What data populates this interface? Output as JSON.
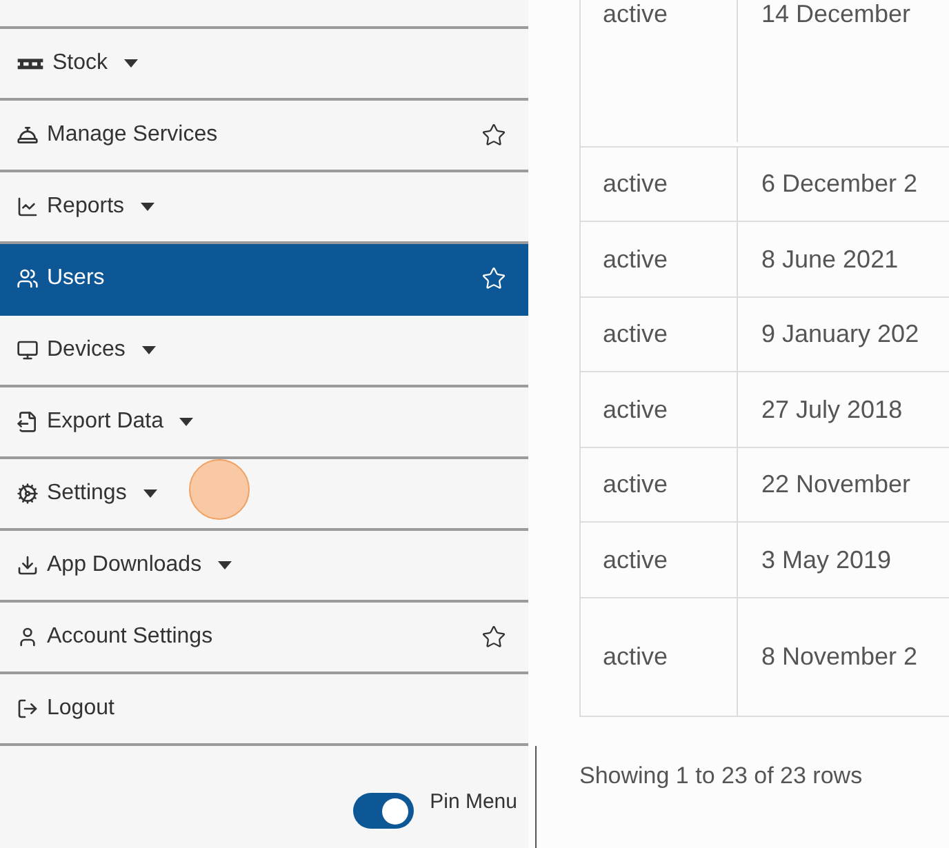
{
  "sidebar": {
    "items": [
      {
        "label": "Stock",
        "dropdown": true,
        "star": false,
        "selected": false
      },
      {
        "label": "Manage Services",
        "dropdown": false,
        "star": true,
        "selected": false
      },
      {
        "label": "Reports",
        "dropdown": true,
        "star": false,
        "selected": false
      },
      {
        "label": "Users",
        "dropdown": false,
        "star": true,
        "selected": true
      },
      {
        "label": "Devices",
        "dropdown": true,
        "star": false,
        "selected": false
      },
      {
        "label": "Export Data",
        "dropdown": true,
        "star": false,
        "selected": false
      },
      {
        "label": "Settings",
        "dropdown": true,
        "star": false,
        "selected": false
      },
      {
        "label": "App Downloads",
        "dropdown": true,
        "star": false,
        "selected": false
      },
      {
        "label": "Account Settings",
        "dropdown": false,
        "star": true,
        "selected": false
      },
      {
        "label": "Logout",
        "dropdown": false,
        "star": false,
        "selected": false
      }
    ],
    "pin_menu": {
      "label": "Pin Menu",
      "on": true
    }
  },
  "table": {
    "rows": [
      {
        "column_1": "active",
        "column_2": "14 December"
      },
      {
        "column_1": "active",
        "column_2": "6 December 2"
      },
      {
        "column_1": "active",
        "column_2": "8 June 2021"
      },
      {
        "column_1": "active",
        "column_2": "9 January 202"
      },
      {
        "column_1": "active",
        "column_2": "27 July 2018"
      },
      {
        "column_1": "active",
        "column_2": "22 November"
      },
      {
        "column_1": "active",
        "column_2": "3 May 2019"
      },
      {
        "column_1": "active",
        "column_2": "8 November 2"
      }
    ],
    "footer": "Showing 1 to 23 of 23 rows"
  }
}
